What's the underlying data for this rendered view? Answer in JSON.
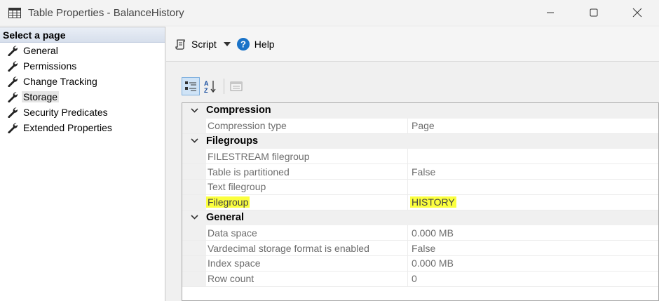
{
  "window": {
    "title": "Table Properties - BalanceHistory",
    "icons": {
      "app": "table-grid-icon",
      "minimize": "minimize-icon",
      "maximize": "maximize-icon",
      "close": "close-icon"
    }
  },
  "left_panel": {
    "header": "Select a page",
    "items": [
      {
        "label": "General",
        "icon": "wrench-icon"
      },
      {
        "label": "Permissions",
        "icon": "wrench-icon"
      },
      {
        "label": "Change Tracking",
        "icon": "wrench-icon"
      },
      {
        "label": "Storage",
        "icon": "wrench-icon",
        "selected": true
      },
      {
        "label": "Security Predicates",
        "icon": "wrench-icon"
      },
      {
        "label": "Extended Properties",
        "icon": "wrench-icon"
      }
    ]
  },
  "toolbar": {
    "script_label": "Script",
    "help_label": "Help"
  },
  "property_grid": {
    "categories": [
      {
        "name": "Compression",
        "properties": [
          {
            "name": "Compression type",
            "value": "Page"
          }
        ]
      },
      {
        "name": "Filegroups",
        "properties": [
          {
            "name": "FILESTREAM filegroup",
            "value": ""
          },
          {
            "name": "Table is partitioned",
            "value": "False"
          },
          {
            "name": "Text filegroup",
            "value": ""
          },
          {
            "name": "Filegroup",
            "value": "HISTORY",
            "highlighted": true
          }
        ]
      },
      {
        "name": "General",
        "properties": [
          {
            "name": "Data space",
            "value": "0.000 MB"
          },
          {
            "name": "Vardecimal storage format is enabled",
            "value": "False"
          },
          {
            "name": "Index space",
            "value": "0.000 MB"
          },
          {
            "name": "Row count",
            "value": "0"
          }
        ]
      }
    ]
  },
  "colors": {
    "highlight": "#fbff3e",
    "help_icon": "#1a73c8",
    "selected_tool": "#cfe3f6"
  }
}
